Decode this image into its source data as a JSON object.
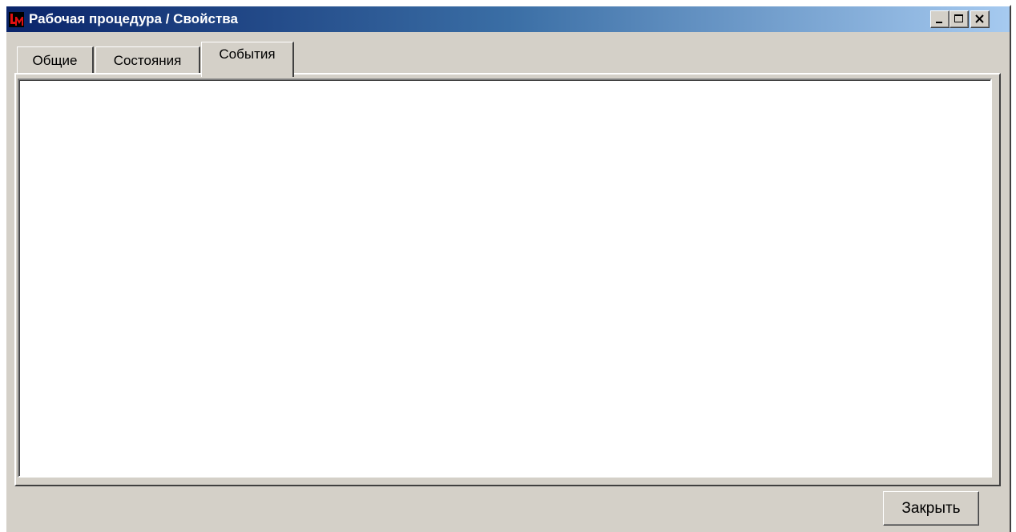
{
  "window": {
    "title": "Рабочая процедура / Свойства"
  },
  "tabs": [
    {
      "label": "Общие",
      "selected": false
    },
    {
      "label": "Состояния",
      "selected": false
    },
    {
      "label": "События",
      "selected": true
    }
  ],
  "footer": {
    "close_label": "Закрыть"
  },
  "colors": {
    "titlebar_start": "#0a246a",
    "titlebar_end": "#a6caf0",
    "face": "#d4d0c8",
    "icon_red": "#e01010"
  },
  "icons": {
    "app": "app-logo-icon",
    "minimize": "minimize-icon",
    "maximize": "maximize-icon",
    "close": "close-icon"
  }
}
